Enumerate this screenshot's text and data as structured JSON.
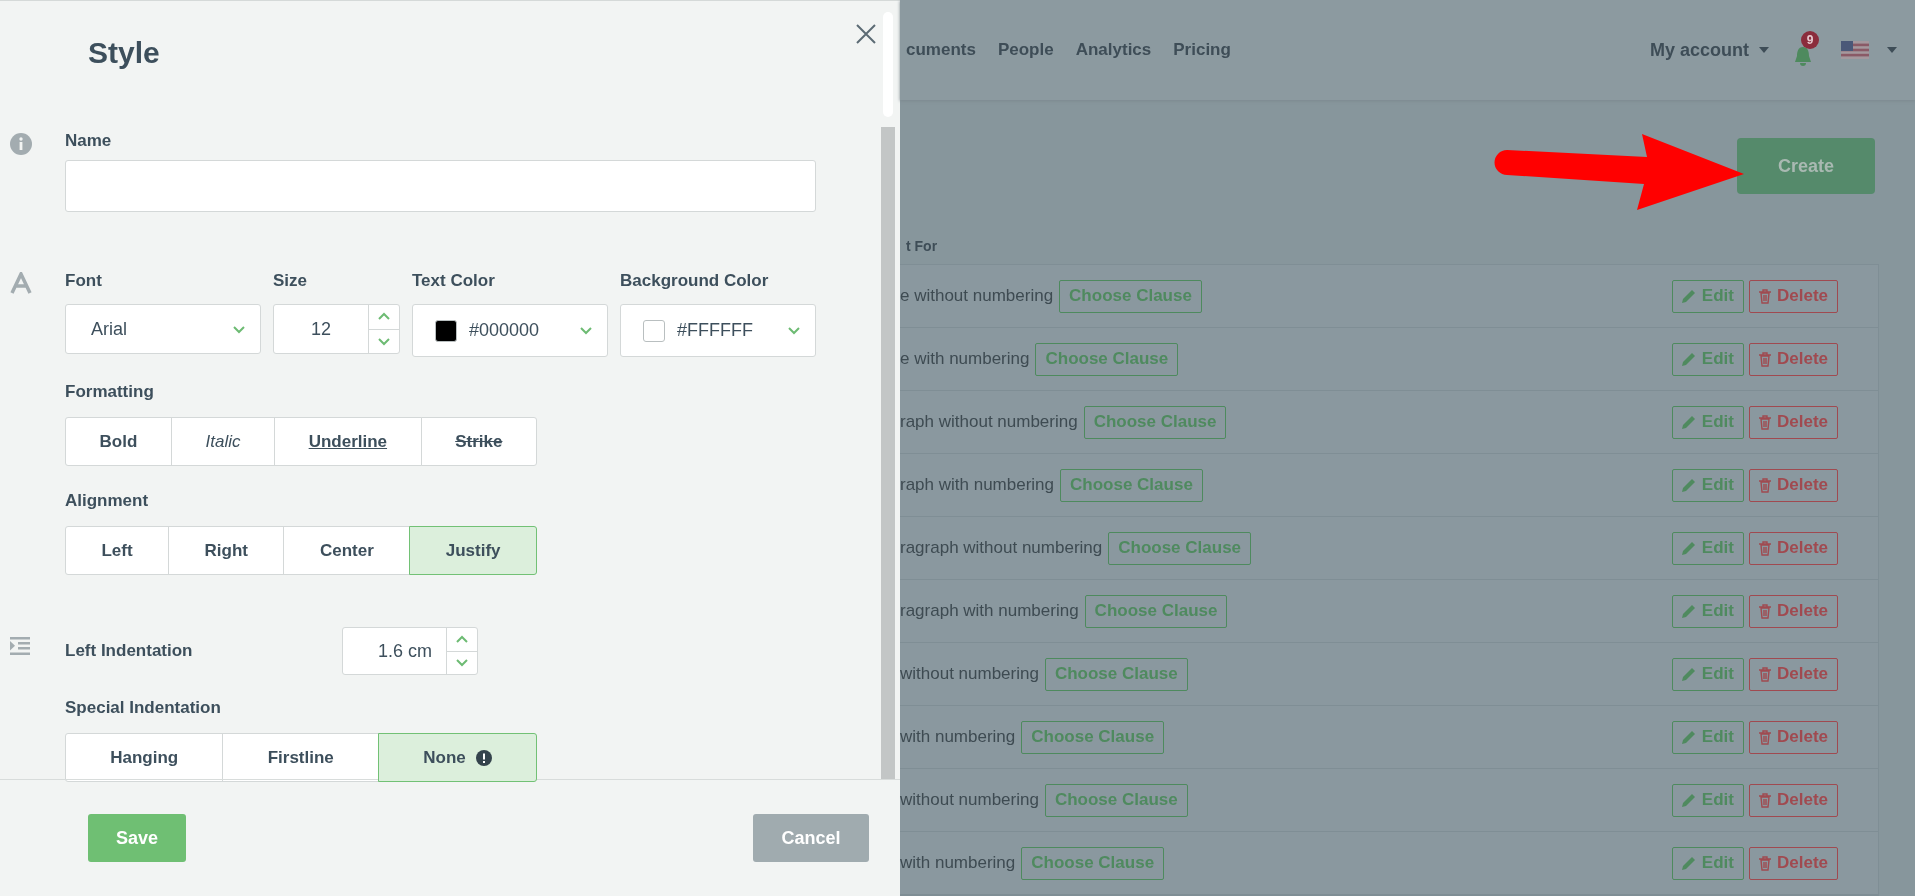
{
  "dialog": {
    "title": "Style",
    "name_field": {
      "label": "Name"
    },
    "font_field": {
      "label": "Font",
      "value": "Arial"
    },
    "size_field": {
      "label": "Size",
      "value": "12"
    },
    "color_fields": [
      {
        "label": "Text Color",
        "value": "#000000",
        "color": "#000000"
      },
      {
        "label": "Background Color",
        "value": "#FFFFFF",
        "color": "#ffffff"
      }
    ],
    "formatting": {
      "label": "Formatting",
      "options": [
        {
          "label": "Bold",
          "kind": "bold",
          "selected": false
        },
        {
          "label": "Italic",
          "kind": "italic",
          "selected": false
        },
        {
          "label": "Underline",
          "kind": "underline",
          "selected": false
        },
        {
          "label": "Strike",
          "kind": "strike",
          "selected": false
        }
      ]
    },
    "alignment": {
      "label": "Alignment",
      "options": [
        {
          "label": "Left",
          "selected": false
        },
        {
          "label": "Right",
          "selected": false
        },
        {
          "label": "Center",
          "selected": false
        },
        {
          "label": "Justify",
          "selected": true
        }
      ]
    },
    "left_indentation": {
      "label": "Left Indentation",
      "value": "1.6 cm"
    },
    "special_indentation": {
      "label": "Special Indentation",
      "options": [
        {
          "label": "Hanging",
          "selected": false,
          "note_icon": false
        },
        {
          "label": "Firstline",
          "selected": false,
          "note_icon": false
        },
        {
          "label": "None",
          "selected": true,
          "note_icon": true
        }
      ]
    },
    "buttons": [
      {
        "label": "Save",
        "kind": "primary"
      },
      {
        "label": "Cancel",
        "kind": "secondary"
      }
    ]
  },
  "page": {
    "nav": [
      "cuments",
      "People",
      "Analytics",
      "Pricing"
    ],
    "account": "My account",
    "notification_count": "9",
    "create_button": "Create",
    "column_header": "t For",
    "rows": [
      {
        "text": "e without numbering",
        "action": "Choose Clause",
        "edit": "Edit",
        "delete": "Delete"
      },
      {
        "text": "e with numbering",
        "action": "Choose Clause",
        "edit": "Edit",
        "delete": "Delete"
      },
      {
        "text": "raph without numbering",
        "action": "Choose Clause",
        "edit": "Edit",
        "delete": "Delete"
      },
      {
        "text": "raph with numbering",
        "action": "Choose Clause",
        "edit": "Edit",
        "delete": "Delete"
      },
      {
        "text": "ragraph without numbering",
        "action": "Choose Clause",
        "edit": "Edit",
        "delete": "Delete"
      },
      {
        "text": "ragraph with numbering",
        "action": "Choose Clause",
        "edit": "Edit",
        "delete": "Delete"
      },
      {
        "text": "without numbering",
        "action": "Choose Clause",
        "edit": "Edit",
        "delete": "Delete"
      },
      {
        "text": "with numbering",
        "action": "Choose Clause",
        "edit": "Edit",
        "delete": "Delete"
      },
      {
        "text": "without numbering",
        "action": "Choose Clause",
        "edit": "Edit",
        "delete": "Delete"
      },
      {
        "text": "with numbering",
        "action": "Choose Clause",
        "edit": "Edit",
        "delete": "Delete"
      }
    ]
  }
}
